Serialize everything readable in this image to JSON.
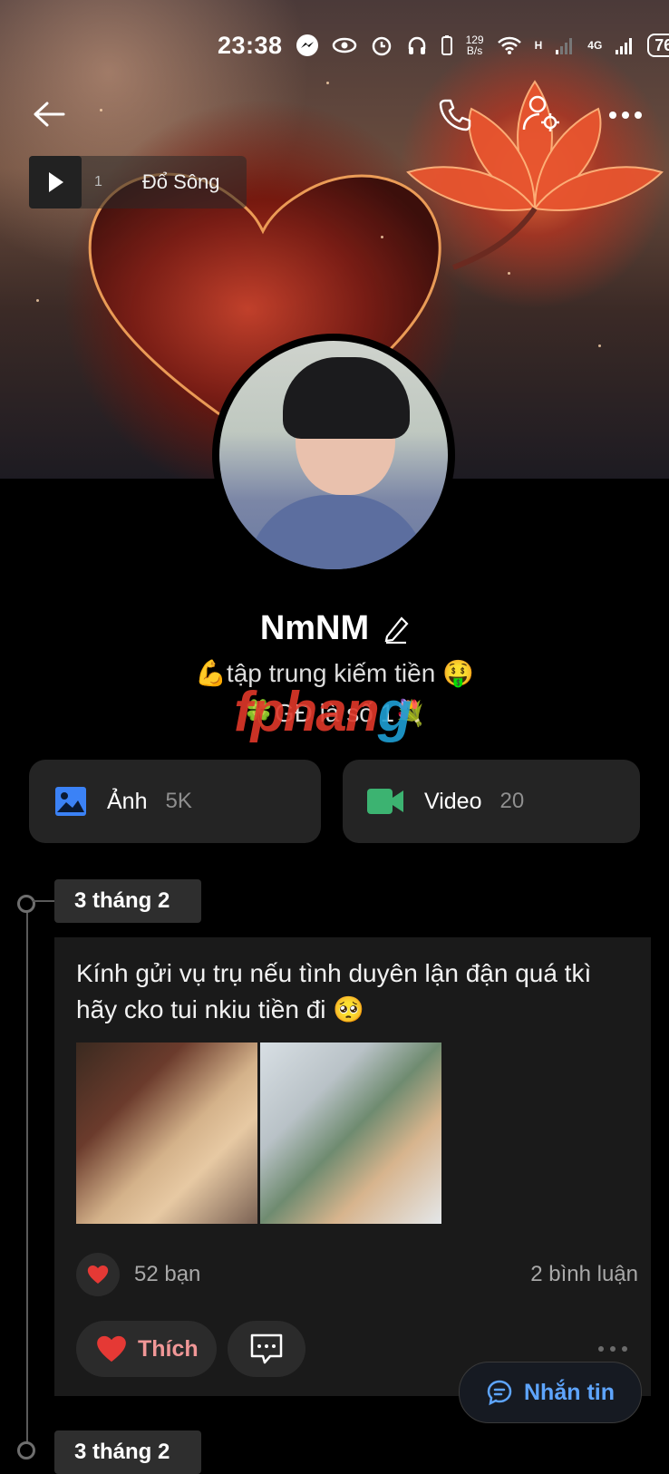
{
  "status_bar": {
    "time": "23:38",
    "net_speed_value": "129",
    "net_speed_unit": "B/s",
    "signal_label_1": "H",
    "signal_label_2": "4G",
    "battery": "76"
  },
  "music": {
    "index": "1",
    "title": "Đổ Sông"
  },
  "profile": {
    "name": "NmNM",
    "bio_line1": "💪tập trung kiếm tiền 🤑",
    "bio_line2": "🍀GĐ là số 1💐"
  },
  "watermark": {
    "text_red": "fphan",
    "text_blue": "g"
  },
  "media": {
    "photos_label": "Ảnh",
    "photos_count": "5K",
    "videos_label": "Video",
    "videos_count": "20"
  },
  "timeline": {
    "date_1": "3 tháng 2",
    "date_2": "3 tháng 2"
  },
  "post": {
    "text": "Kính gửi vụ trụ nếu tình duyên lận đận quá tkì hãy cko tui nkiu tiền đi 🥺",
    "likes": "52 bạn",
    "comments": "2 bình luận",
    "like_button": "Thích"
  },
  "message_button": {
    "label": "Nhắn tin"
  },
  "colors": {
    "accent_blue": "#5ea5ff",
    "photo_icon": "#3b82f6",
    "video_icon": "#3cb371",
    "like_red": "#e53935"
  }
}
